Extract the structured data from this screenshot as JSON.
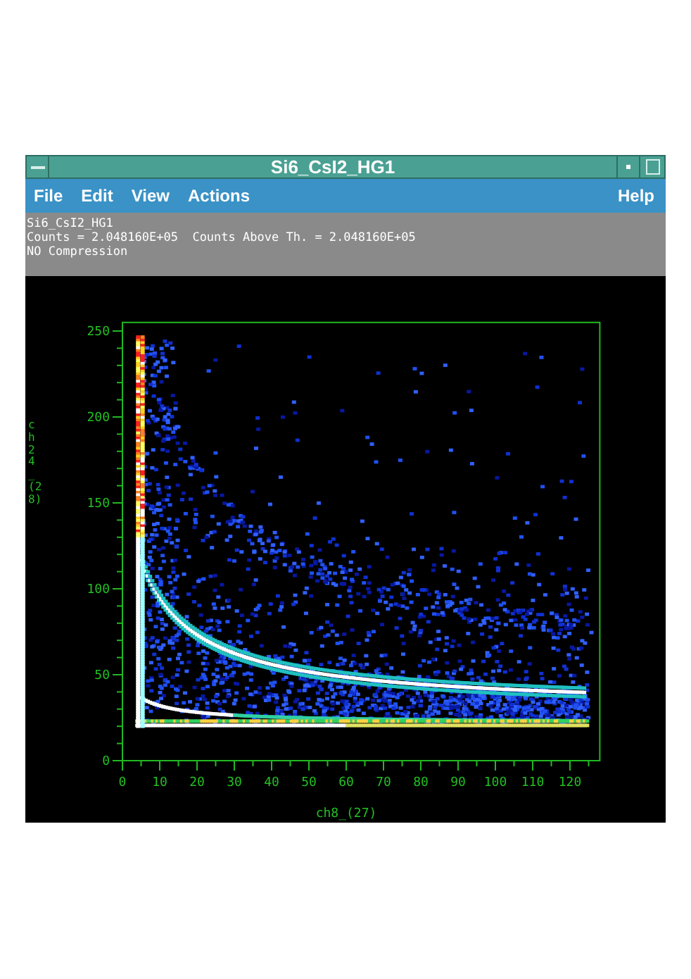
{
  "window": {
    "title": "Si6_CsI2_HG1"
  },
  "menu": {
    "left": [
      "File",
      "Edit",
      "View",
      "Actions"
    ],
    "right": [
      "Help"
    ]
  },
  "info": [
    "Si6_CsI2_HG1",
    "Counts = 2.048160E+05  Counts Above Th. = 2.048160E+05",
    "NO Compression"
  ],
  "plot": {
    "xticks": [
      "0",
      "10",
      "20",
      "30",
      "40",
      "50",
      "60",
      "70",
      "80",
      "90",
      "100",
      "110",
      "120"
    ],
    "yticks": [
      "250",
      "200",
      "150",
      "100",
      "50",
      "0"
    ],
    "xlabel": "ch8_(27)",
    "ylabel": "ch24_(28)"
  }
}
